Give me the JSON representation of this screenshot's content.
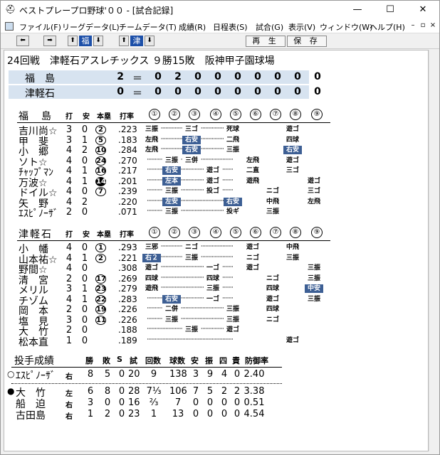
{
  "window": {
    "title": "ベストプレープロ野球'００ - [試合記録]",
    "min": "—",
    "max": "☐",
    "close": "✕"
  },
  "menu": [
    "ファイル(F)",
    "リーグデータ(L)",
    "チームデータ(T)",
    "成績(R)",
    "日程表(S)",
    "試合(G)",
    "表示(V)",
    "ウィンドウ(W)",
    "ヘルプ(H)"
  ],
  "toolbar": {
    "team1": "福",
    "team2": "津",
    "play": "再 生",
    "save": "保 存"
  },
  "game": {
    "header": "24回戦　津軽石アスレチックス ９勝15敗　阪神甲子園球場"
  },
  "scoreboard": [
    {
      "team": "福　島",
      "total": "2",
      "innings": [
        "0",
        "2",
        "0",
        "0",
        "0",
        "0",
        "0",
        "0",
        "0"
      ]
    },
    {
      "team": "津軽石",
      "total": "0",
      "innings": [
        "0",
        "0",
        "0",
        "0",
        "0",
        "0",
        "0",
        "0",
        "0"
      ]
    }
  ],
  "cols": {
    "ab": "打",
    "h": "安",
    "hr": "本塁",
    "avg": "打率",
    "inn": [
      "①",
      "②",
      "③",
      "④",
      "⑤",
      "⑥",
      "⑦",
      "⑧",
      "⑨"
    ]
  },
  "teams": [
    {
      "name": "福　島",
      "players": [
        {
          "name": "吉川尚☆",
          "ab": "3",
          "h": "0",
          "hr": "2",
          "hrf": false,
          "avg": ".223",
          "res": [
            [
              "三振",
              1
            ],
            null,
            [
              "三ゴ",
              3
            ],
            null,
            [
              "死球",
              5
            ],
            null,
            null,
            [
              "遊ゴ",
              8
            ],
            null
          ]
        },
        {
          "name": "甲　斐",
          "ab": "3",
          "h": "1",
          "hr": "5",
          "hrf": false,
          "avg": ".183",
          "res": [
            [
              "左飛",
              1
            ],
            null,
            [
              "右安",
              3,
              true
            ],
            null,
            [
              "二飛",
              5
            ],
            null,
            null,
            [
              "四球",
              8
            ],
            null
          ]
        },
        {
          "name": "小　郷",
          "ab": "4",
          "h": "2",
          "hr": "10",
          "hrf": false,
          "avg": ".284",
          "res": [
            [
              "左飛",
              1
            ],
            null,
            [
              "右安",
              3,
              true
            ],
            null,
            [
              "三振",
              5
            ],
            null,
            null,
            [
              "右安",
              8,
              true
            ],
            null
          ]
        },
        {
          "name": "ソト☆",
          "ab": "4",
          "h": "0",
          "hr": "24",
          "hrf": false,
          "avg": ".270",
          "res": [
            null,
            [
              "三振",
              2
            ],
            [
              "三併",
              3
            ],
            null,
            null,
            [
              "左飛",
              6
            ],
            null,
            [
              "遊ゴ",
              8
            ],
            null
          ]
        },
        {
          "name": "ﾁｬｯﾌﾟﾏﾝ",
          "ab": "4",
          "h": "1",
          "hr": "16",
          "hrf": false,
          "avg": ".217",
          "res": [
            null,
            [
              "右安",
              2,
              true
            ],
            null,
            [
              "遊ゴ",
              4
            ],
            null,
            [
              "二直",
              6
            ],
            null,
            [
              "三ゴ",
              8
            ],
            null
          ]
        },
        {
          "name": "万波☆",
          "ab": "4",
          "h": "1",
          "hr": "14",
          "hrf": true,
          "avg": ".201",
          "res": [
            null,
            [
              "左本",
              2,
              true
            ],
            null,
            [
              "遊ゴ",
              4
            ],
            null,
            [
              "遊飛",
              6
            ],
            null,
            null,
            [
              "遊ゴ",
              9
            ]
          ]
        },
        {
          "name": "ドイル☆",
          "ab": "4",
          "h": "0",
          "hr": "7",
          "hrf": false,
          "avg": ".239",
          "res": [
            null,
            [
              "三振",
              2
            ],
            null,
            [
              "投ゴ",
              4
            ],
            null,
            null,
            [
              "ニゴ",
              7
            ],
            null,
            [
              "三ゴ",
              9
            ]
          ]
        },
        {
          "name": "矢　野",
          "ab": "4",
          "h": "2",
          "hr": "",
          "hrf": false,
          "avg": ".220",
          "res": [
            null,
            [
              "左安",
              2,
              true
            ],
            null,
            null,
            [
              "右安",
              5,
              true
            ],
            null,
            [
              "中飛",
              7
            ],
            null,
            [
              "左飛",
              9
            ]
          ]
        },
        {
          "name": "ｴｽﾋﾟﾉｰｻﾞ",
          "ab": "2",
          "h": "0",
          "hr": "",
          "hrf": false,
          "avg": ".071",
          "res": [
            null,
            [
              "三振",
              2
            ],
            null,
            null,
            [
              "投ギ",
              5
            ],
            null,
            [
              "三振",
              7
            ],
            null,
            null
          ]
        }
      ]
    },
    {
      "name": "津軽石",
      "players": [
        {
          "name": "小　幡",
          "ab": "4",
          "h": "0",
          "hr": "1",
          "hrf": false,
          "avg": ".293",
          "res": [
            [
              "三邪",
              1
            ],
            null,
            [
              "ニゴ",
              3
            ],
            null,
            null,
            [
              "遊ゴ",
              6
            ],
            null,
            [
              "中飛",
              8
            ],
            null
          ]
        },
        {
          "name": "山本祐☆",
          "ab": "4",
          "h": "1",
          "hr": "2",
          "hrf": false,
          "avg": ".221",
          "res": [
            [
              "右２",
              1,
              true
            ],
            null,
            [
              "三振",
              3
            ],
            null,
            null,
            [
              "ニゴ",
              6
            ],
            null,
            [
              "三振",
              8
            ],
            null
          ]
        },
        {
          "name": "野間☆",
          "ab": "4",
          "h": "0",
          "hr": "",
          "hrf": false,
          "avg": ".308",
          "res": [
            [
              "遊ゴ",
              1
            ],
            null,
            null,
            [
              "一ゴ",
              4
            ],
            null,
            [
              "遊ゴ",
              6
            ],
            null,
            null,
            [
              "三振",
              9
            ]
          ]
        },
        {
          "name": "清　宮",
          "ab": "2",
          "h": "0",
          "hr": "17",
          "hrf": false,
          "avg": ".269",
          "res": [
            [
              "四球",
              1
            ],
            null,
            null,
            [
              "四球",
              4
            ],
            null,
            null,
            [
              "ニゴ",
              7
            ],
            null,
            [
              "三振",
              9
            ]
          ]
        },
        {
          "name": "メリル",
          "ab": "3",
          "h": "1",
          "hr": "23",
          "hrf": false,
          "avg": ".279",
          "res": [
            [
              "遊飛",
              1
            ],
            null,
            null,
            [
              "三振",
              4
            ],
            null,
            null,
            [
              "四球",
              7
            ],
            null,
            [
              "中安",
              9,
              true
            ]
          ]
        },
        {
          "name": "チゾム",
          "ab": "4",
          "h": "1",
          "hr": "22",
          "hrf": false,
          "avg": ".283",
          "res": [
            null,
            [
              "右安",
              2,
              true
            ],
            null,
            [
              "一ゴ",
              4
            ],
            null,
            null,
            [
              "遊ゴ",
              7
            ],
            null,
            [
              "三振",
              9
            ]
          ]
        },
        {
          "name": "岡　本",
          "ab": "2",
          "h": "0",
          "hr": "19",
          "hrf": false,
          "avg": ".226",
          "res": [
            null,
            [
              "二併",
              2
            ],
            null,
            null,
            [
              "三振",
              5
            ],
            null,
            [
              "四球",
              7
            ],
            null,
            null
          ]
        },
        {
          "name": "塩　見",
          "ab": "3",
          "h": "0",
          "hr": "11",
          "hrf": false,
          "avg": ".226",
          "res": [
            null,
            [
              "三振",
              2
            ],
            null,
            null,
            [
              "三振",
              5
            ],
            null,
            [
              "ニゴ",
              7
            ],
            null,
            null
          ]
        },
        {
          "name": "大　竹",
          "ab": "2",
          "h": "0",
          "hr": "",
          "hrf": false,
          "avg": ".188",
          "res": [
            null,
            null,
            [
              "三振",
              3
            ],
            null,
            [
              "遊ゴ",
              5
            ],
            null,
            null,
            null,
            null
          ]
        },
        {
          "name": "松本直",
          "ab": "1",
          "h": "0",
          "hr": "",
          "hrf": false,
          "avg": ".189",
          "res": [
            null,
            null,
            null,
            null,
            null,
            null,
            null,
            [
              "遊ゴ",
              8
            ],
            null
          ]
        }
      ]
    }
  ],
  "pitching": {
    "title": "投手成績",
    "cols": [
      "勝",
      "敗",
      "S",
      "試",
      "回数",
      "球数",
      "安",
      "振",
      "四",
      "責",
      "防御率"
    ],
    "rows": [
      {
        "mark": "○",
        "name": "ｴｽﾋﾟﾉｰｻﾞ",
        "hand": "右",
        "vals": [
          "8",
          "5",
          "0",
          "20",
          "9",
          "138",
          "3",
          "9",
          "4",
          "0",
          "2.40"
        ]
      },
      {
        "mark": "●",
        "name": "大　竹",
        "hand": "左",
        "vals": [
          "6",
          "8",
          "0",
          "28",
          "7⅓",
          "106",
          "7",
          "5",
          "2",
          "2",
          "3.38"
        ]
      },
      {
        "mark": "",
        "name": "船　迫",
        "hand": "右",
        "vals": [
          "3",
          "0",
          "0",
          "16",
          "⅔",
          "7",
          "0",
          "0",
          "0",
          "0",
          "0.51"
        ]
      },
      {
        "mark": "",
        "name": "古田島",
        "hand": "右",
        "vals": [
          "1",
          "2",
          "0",
          "23",
          "1",
          "13",
          "0",
          "0",
          "0",
          "0",
          "4.54"
        ]
      }
    ]
  }
}
